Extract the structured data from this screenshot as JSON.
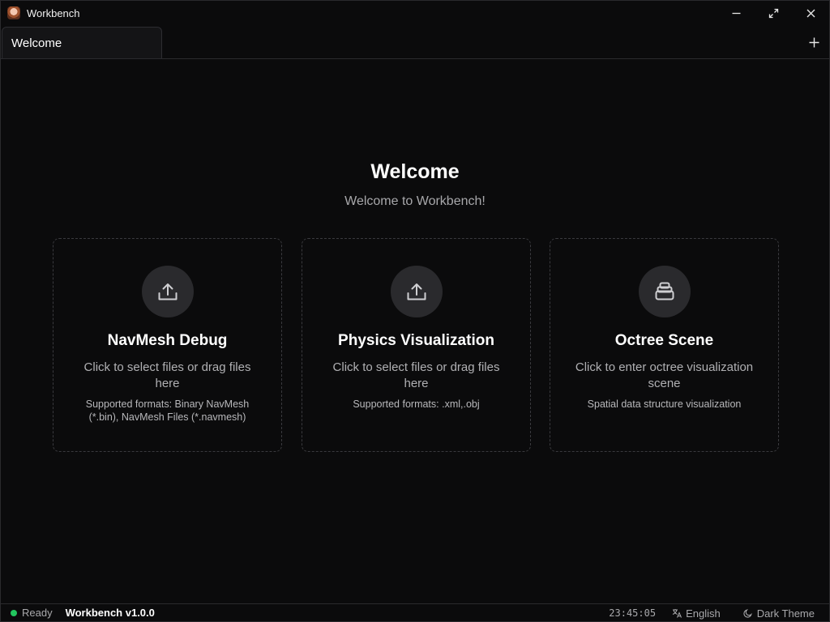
{
  "window": {
    "title": "Workbench",
    "controls": [
      "minimize-icon",
      "maximize-icon",
      "close-icon"
    ]
  },
  "tabs": [
    {
      "label": "Welcome",
      "active": true
    }
  ],
  "tab_add_icon": "plus-icon",
  "main": {
    "title": "Welcome",
    "subtitle": "Welcome to Workbench!",
    "cards": [
      {
        "icon": "upload-icon",
        "title": "NavMesh Debug",
        "description": "Click to select files or drag files here",
        "note": "Supported formats: Binary NavMesh (*.bin), NavMesh Files (*.navmesh)"
      },
      {
        "icon": "upload-icon",
        "title": "Physics Visualization",
        "description": "Click to select files or drag files here",
        "note": "Supported formats: .xml,.obj"
      },
      {
        "icon": "layers-icon",
        "title": "Octree Scene",
        "description": "Click to enter octree visualization scene",
        "note": "Spatial data structure visualization"
      }
    ]
  },
  "status": {
    "state": "Ready",
    "state_color": "#22c55e",
    "version": "Workbench v1.0.0",
    "time": "23:45:05",
    "language": "English",
    "theme": "Dark Theme"
  }
}
